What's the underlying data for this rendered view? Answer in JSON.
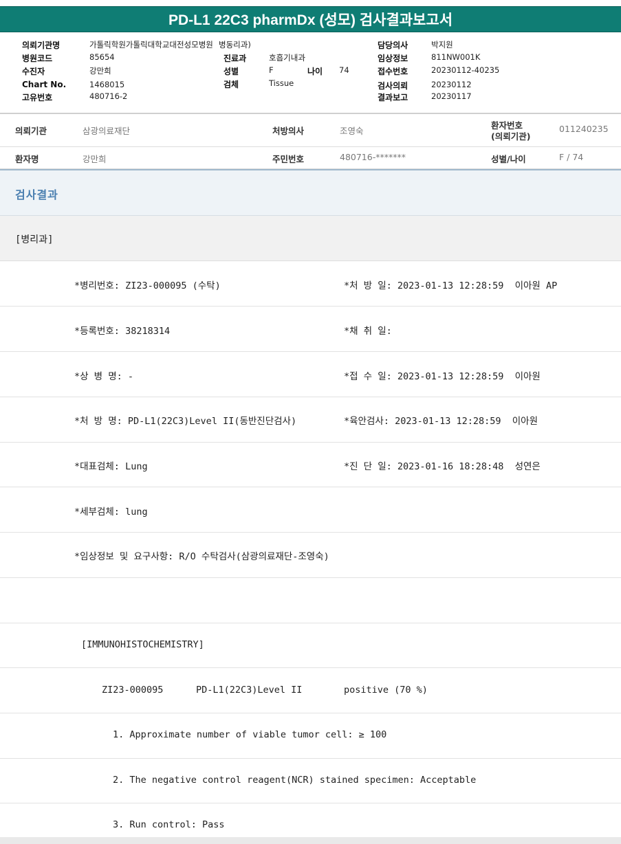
{
  "report_title": "PD-L1 22C3 pharmDx (성모) 검사결과보고서",
  "header": {
    "institution_label": "의뢰기관명",
    "institution_value": "가톨릭학원가톨릭대학교대전성모병원",
    "dept_suffix": "병동리과)",
    "hospital_code_label": "병원코드",
    "hospital_code_value": "85654",
    "recipient_label": "수진자",
    "recipient_value": "강만희",
    "chart_no_label": "Chart No.",
    "chart_no_value": "1468015",
    "unique_no_label": "고유번호",
    "unique_no_value": "480716-2",
    "clinic_label": "진료과",
    "clinic_value": "호흡기내과",
    "sex_label": "성별",
    "sex_value": "F",
    "age_label": "나이",
    "age_value": "74",
    "specimen_label": "검체",
    "specimen_value": "Tissue",
    "doctor_label": "담당의사",
    "doctor_value": "박지원",
    "clinical_info_label": "임상정보",
    "clinical_info_value": "811NW001K",
    "receipt_no_label": "접수번호",
    "receipt_no_value": "20230112-40235",
    "request_label": "검사의뢰",
    "request_value": "20230112",
    "report_label": "결과보고",
    "report_value": "20230117"
  },
  "patient_info": {
    "requesting_org_label": "의뢰기관",
    "requesting_org_value": "삼광의료재단",
    "prescriber_label": "처방의사",
    "prescriber_value": "조영숙",
    "patient_no_label_1": "환자번호",
    "patient_no_label_2": "(의뢰기관)",
    "patient_no_value": "011240235",
    "patient_name_label": "환자명",
    "patient_name_value": "강만희",
    "resident_no_label": "주민번호",
    "resident_no_value": "480716-*******",
    "sex_age_label": "성별/나이",
    "sex_age_value": "F / 74"
  },
  "result_section_title": "검사결과",
  "department_label": "[병리과]",
  "result_lines": {
    "path_no": "*병리번호: ZI23-000095 (수탁)",
    "prescribed_date": "*처 방 일: 2023-01-13 12:28:59  이아원 AP",
    "reg_no": "*등록번호: 38218314",
    "collected_date": "*채 취 일:",
    "disease_name": "*상 병 명: -",
    "received_date": "*접 수 일: 2023-01-13 12:28:59  이아원",
    "prescription_name": "*처 방 명: PD-L1(22C3)Level II(동반진단검사)",
    "gross_exam": "*육안검사: 2023-01-13 12:28:59  이아원",
    "rep_specimen": "*대표검체: Lung",
    "diagnosis_date": "*진 단 일: 2023-01-16 18:28:48  성연은",
    "detail_specimen": "*세부검체: lung",
    "clinical_request": "*임상정보 및 요구사항: R/O 수탁검사(삼광의료재단-조영숙)",
    "ihc_header": "[IMMUNOHISTOCHEMISTRY]",
    "ihc_case": "ZI23-000095",
    "ihc_test": "PD-L1(22C3)Level II",
    "ihc_result": "positive (70 %)",
    "item_1": "1. Approximate number of viable tumor cell: ≥ 100",
    "item_2": "2. The negative control reagent(NCR) stained specimen: Acceptable",
    "item_3": "3. Run control: Pass"
  }
}
